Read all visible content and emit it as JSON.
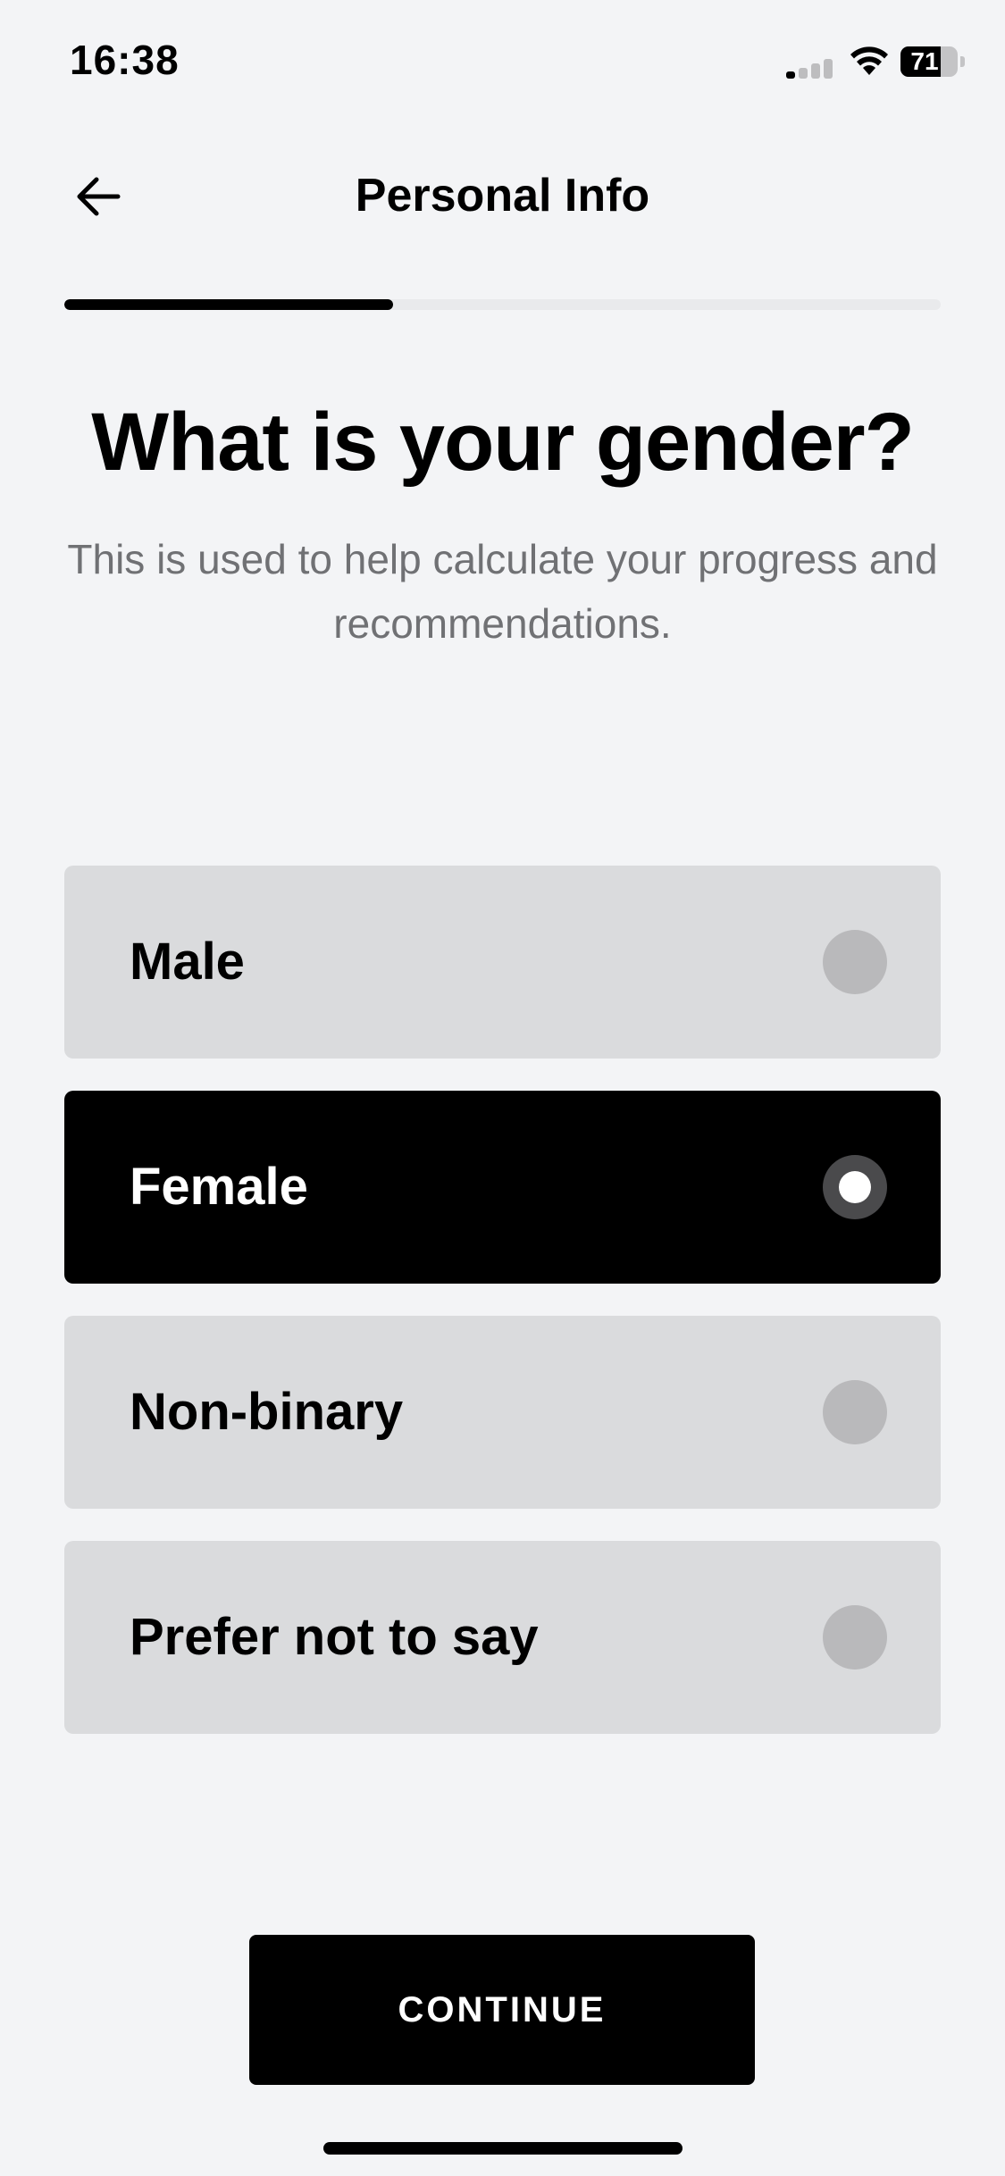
{
  "status_bar": {
    "time": "16:38",
    "battery_level": "71",
    "battery_fraction": 0.71,
    "signal_bars_active": 1,
    "signal_bars_total": 4
  },
  "nav": {
    "title": "Personal Info",
    "back_icon": "arrow-left-icon"
  },
  "progress": {
    "fraction": 0.375
  },
  "question": {
    "headline": "What is your gender?",
    "subtitle": "This is used to help calculate your progress and recommendations."
  },
  "options": [
    {
      "label": "Male",
      "selected": false
    },
    {
      "label": "Female",
      "selected": true
    },
    {
      "label": "Non-binary",
      "selected": false
    },
    {
      "label": "Prefer not to say",
      "selected": false
    }
  ],
  "continue_label": "CONTINUE",
  "colors": {
    "background": "#f3f4f6",
    "option_default": "#dadbdd",
    "option_selected": "#000000",
    "subtitle_text": "#707174",
    "accent": "#000000"
  }
}
